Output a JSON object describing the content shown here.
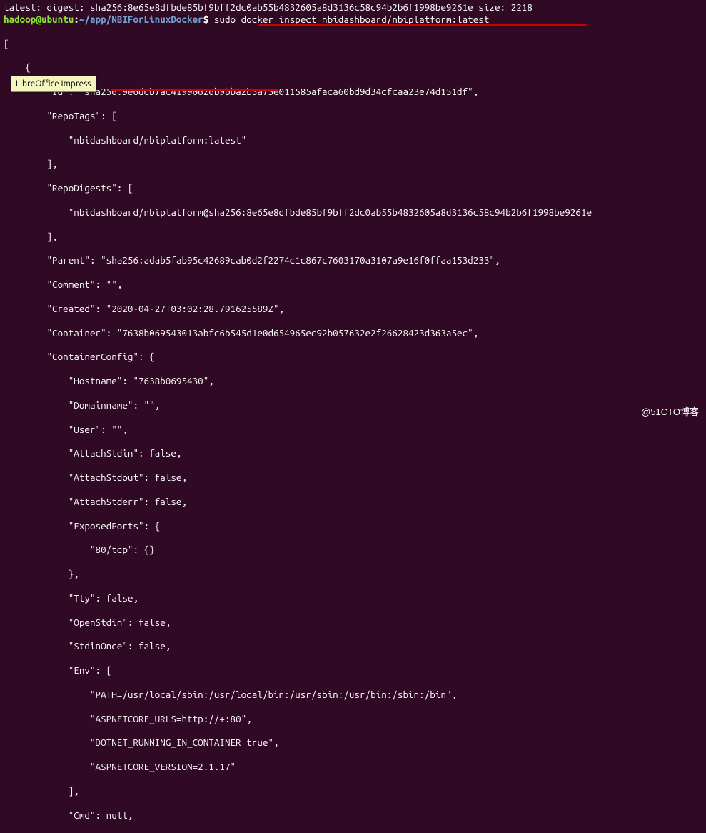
{
  "tooltip": {
    "text": "LibreOffice Impress"
  },
  "watermark": {
    "text": "@51CTO博客"
  },
  "line1": {
    "text": "latest: digest: sha256:8e65e8dfbde85bf9bff2dc0ab55b4832605a8d3136c58c94b2b6f1998be9261e size: 2218"
  },
  "prompt": {
    "user": "hadoop@ubuntu",
    "colon": ":",
    "path": "~/app/NBIForLinuxDocker",
    "dollar": "$ ",
    "command": "sudo docker inspect nbidashboard/nbiplatform:latest"
  },
  "out": {
    "l01": "[",
    "l02": "    {",
    "l03": "        \"Id\": \"sha256:9e6dcb7ac41990626b9bba2b5a75e011585afaca60bd9d34cfcaa23e74d151df\",",
    "l04": "        \"RepoTags\": [",
    "l05": "            \"nbidashboard/nbiplatform:latest\"",
    "l06": "        ],",
    "l07": "        \"RepoDigests\": [",
    "l08": "            \"nbidashboard/nbiplatform@sha256:8e65e8dfbde85bf9bff2dc0ab55b4832605a8d3136c58c94b2b6f1998be9261e",
    "l09": "        ],",
    "l10": "        \"Parent\": \"sha256:adab5fab95c42689cab0d2f2274c1c867c7603170a3107a9e16f0ffaa153d233\",",
    "l11": "        \"Comment\": \"\",",
    "l12": "        \"Created\": \"2020-04-27T03:02:28.791625589Z\",",
    "l13": "        \"Container\": \"7638b069543013abfc6b545d1e0d654965ec92b057632e2f26628423d363a5ec\",",
    "l14": "        \"ContainerConfig\": {",
    "l15": "            \"Hostname\": \"7638b0695430\",",
    "l16": "            \"Domainname\": \"\",",
    "l17": "            \"User\": \"\",",
    "l18": "            \"AttachStdin\": false,",
    "l19": "            \"AttachStdout\": false,",
    "l20": "            \"AttachStderr\": false,",
    "l21": "            \"ExposedPorts\": {",
    "l22": "                \"80/tcp\": {}",
    "l23": "            },",
    "l24": "            \"Tty\": false,",
    "l25": "            \"OpenStdin\": false,",
    "l26": "            \"StdinOnce\": false,",
    "l27": "            \"Env\": [",
    "l28": "                \"PATH=/usr/local/sbin:/usr/local/bin:/usr/sbin:/usr/bin:/sbin:/bin\",",
    "l29": "                \"ASPNETCORE_URLS=http://+:80\",",
    "l30": "                \"DOTNET_RUNNING_IN_CONTAINER=true\",",
    "l31": "                \"ASPNETCORE_VERSION=2.1.17\"",
    "l32": "            ],",
    "l33": "            \"Cmd\": null,"
  }
}
